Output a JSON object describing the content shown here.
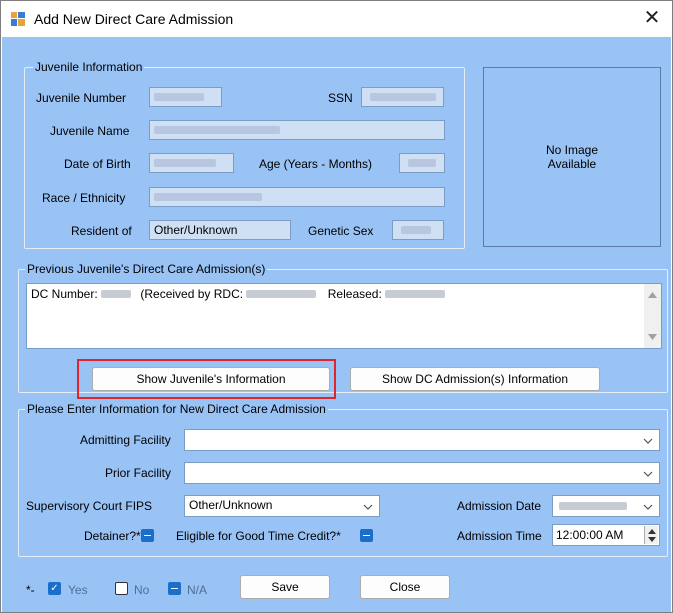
{
  "window": {
    "title": "Add New Direct Care Admission",
    "close_label": "✕"
  },
  "juvenile_info": {
    "group_title": "Juvenile Information",
    "juvenile_number_label": "Juvenile Number",
    "ssn_label": "SSN",
    "juvenile_name_label": "Juvenile Name",
    "dob_label": "Date of Birth",
    "age_label": "Age (Years - Months)",
    "race_label": "Race / Ethnicity",
    "resident_label": "Resident of",
    "resident_value": "Other/Unknown",
    "genetic_sex_label": "Genetic Sex"
  },
  "photo": {
    "text": "No Image\nAvailable"
  },
  "previous_admissions": {
    "group_title": "Previous Juvenile's Direct Care Admission(s)",
    "row_dc_label": "DC Number:",
    "row_received_label": "(Received by RDC:",
    "row_released_label": "Released:"
  },
  "buttons": {
    "show_juvenile": "Show Juvenile's Information",
    "show_dc": "Show DC Admission(s) Information",
    "save": "Save",
    "close": "Close"
  },
  "new_admission": {
    "group_title": "Please Enter Information for New Direct Care Admission",
    "admitting_facility_label": "Admitting Facility",
    "admitting_facility_value": "",
    "prior_facility_label": "Prior Facility",
    "prior_facility_value": "",
    "court_fips_label": "Supervisory Court FIPS",
    "court_fips_value": "Other/Unknown",
    "admission_date_label": "Admission Date",
    "detainer_label": "Detainer?*",
    "good_time_label": "Eligible for Good Time Credit?*",
    "admission_time_label": "Admission Time",
    "admission_time_value": "12:00:00 AM"
  },
  "legend": {
    "prefix": "*-",
    "yes": "Yes",
    "no": "No",
    "na": "N/A"
  },
  "colors": {
    "client_bg": "#99c2f5",
    "checkbox_blue": "#1b6fc9",
    "highlight_red": "#e0262c"
  }
}
